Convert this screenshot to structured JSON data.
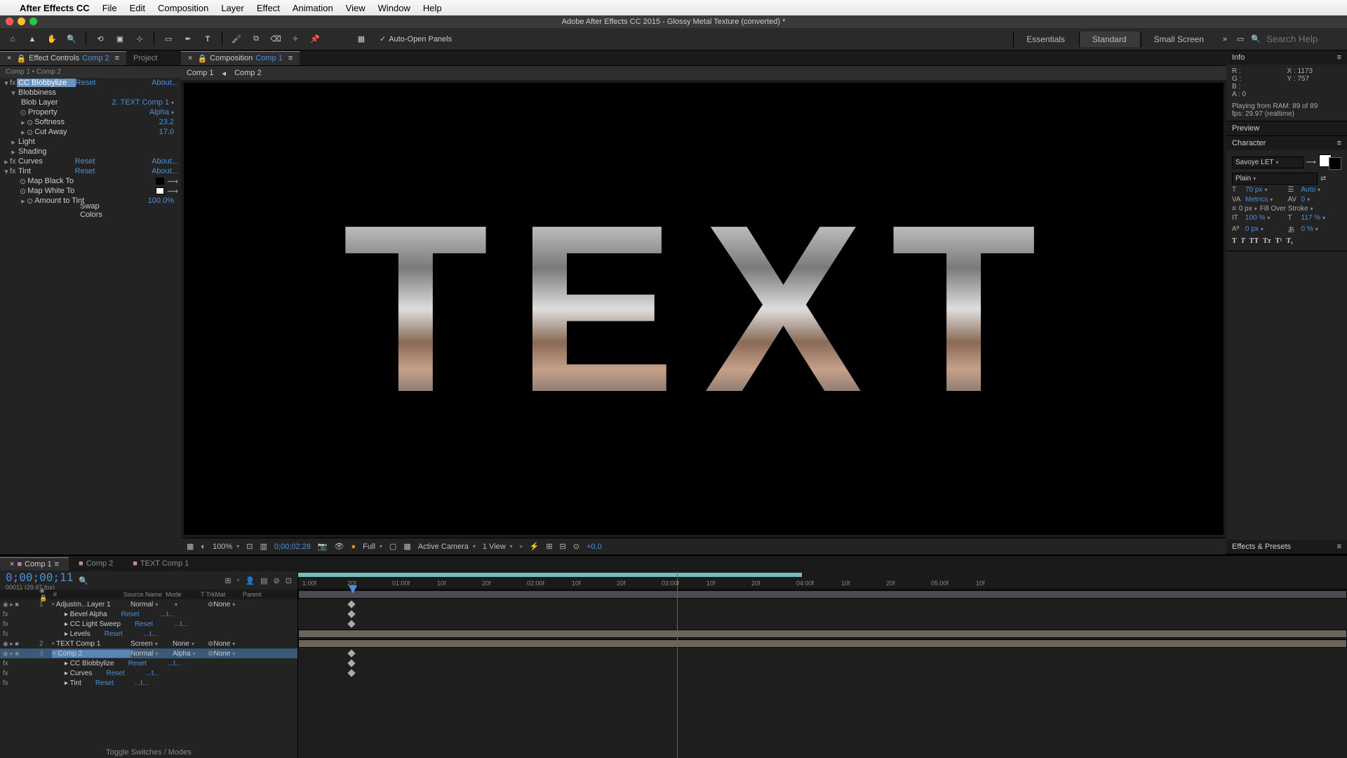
{
  "mac_menu": {
    "app": "After Effects CC",
    "items": [
      "File",
      "Edit",
      "Composition",
      "Layer",
      "Effect",
      "Animation",
      "View",
      "Window",
      "Help"
    ]
  },
  "title_bar": "Adobe After Effects CC 2015 - Glossy Metal Texture (converted) *",
  "toolbar": {
    "auto_open": "Auto-Open Panels",
    "workspaces": [
      "Essentials",
      "Standard",
      "Small Screen"
    ],
    "search_ph": "Search Help"
  },
  "left": {
    "tabs": {
      "ec": "Effect Controls",
      "ec_target": "Comp 2",
      "project": "Project"
    },
    "breadcrumb": "Comp 1 • Comp 2",
    "fx": {
      "blobbylize": {
        "name": "CC Blobbylize",
        "reset": "Reset",
        "about": "About...",
        "blobbiness": "Blobbiness",
        "blob_layer": {
          "label": "Blob Layer",
          "value": "2. TEXT Comp 1"
        },
        "property": {
          "label": "Property",
          "value": "Alpha"
        },
        "softness": {
          "label": "Softness",
          "value": "23.2"
        },
        "cut_away": {
          "label": "Cut Away",
          "value": "17.0"
        },
        "light": "Light",
        "shading": "Shading"
      },
      "curves": {
        "name": "Curves",
        "reset": "Reset",
        "about": "About..."
      },
      "tint": {
        "name": "Tint",
        "reset": "Reset",
        "about": "About...",
        "map_black": "Map Black To",
        "map_white": "Map White To",
        "amount": {
          "label": "Amount to Tint",
          "value": "100.0%"
        },
        "swap": "Swap Colors"
      }
    }
  },
  "comp": {
    "tab_label": "Composition",
    "tab_target": "Comp 1",
    "sub1": "Comp 1",
    "sub2": "Comp 2",
    "render_text": "TEXT",
    "footer": {
      "mag": "100%",
      "time": "0;00;02;28",
      "res": "Full",
      "camera": "Active Camera",
      "view": "1 View",
      "exp": "+0.0"
    }
  },
  "right": {
    "info": {
      "title": "Info",
      "r": "R :",
      "g": "G :",
      "b": "B :",
      "a": "A : 0",
      "x": "X : 1173",
      "y": "Y : 757",
      "ram": "Playing from RAM: 89 of 89",
      "fps": "fps: 29.97 (realtime)"
    },
    "preview": "Preview",
    "character": {
      "title": "Character",
      "font": "Savoye LET",
      "style": "Plain",
      "size": "70 px",
      "leading": "Auto",
      "kerning": "Metrics",
      "tracking": "0",
      "stroke": "0 px",
      "fill_over": "Fill Over Stroke",
      "vscale": "100 %",
      "hscale": "117 %",
      "baseline": "0 px",
      "tsume": "0 %"
    },
    "ep": "Effects & Presets"
  },
  "timeline": {
    "tabs": [
      "Comp 1",
      "Comp 2",
      "TEXT Comp 1"
    ],
    "timecode": "0;00;00;11",
    "frames": "00011 (29.97 fps)",
    "cols": {
      "num": "#",
      "src": "Source Name",
      "mode": "Mode",
      "trk": "T TrkMat",
      "parent": "Parent"
    },
    "toggle": "Toggle Switches / Modes",
    "ruler": [
      "1:00f",
      "20f",
      "01:00f",
      "10f",
      "20f",
      "02:00f",
      "10f",
      "20f",
      "03:00f",
      "10f",
      "20f",
      "04:00f",
      "10f",
      "20f",
      "05:00f",
      "10f"
    ],
    "layers": [
      {
        "num": "1",
        "name": "Adjustm...Layer 1",
        "mode": "Normal",
        "trk": "",
        "parent": "None",
        "subs": [
          {
            "n": "Bevel Alpha"
          },
          {
            "n": "CC Light Sweep"
          },
          {
            "n": "Levels"
          }
        ]
      },
      {
        "num": "2",
        "name": "TEXT Comp 1",
        "mode": "Screen",
        "trk": "None",
        "parent": "None",
        "subs": []
      },
      {
        "num": "3",
        "name": "Comp 2",
        "mode": "Normal",
        "trk": "Alpha",
        "parent": "None",
        "sel": true,
        "subs": [
          {
            "n": "CC Blobbylize"
          },
          {
            "n": "Curves"
          },
          {
            "n": "Tint"
          }
        ]
      }
    ],
    "reset": "Reset",
    "dots": "...t..."
  }
}
